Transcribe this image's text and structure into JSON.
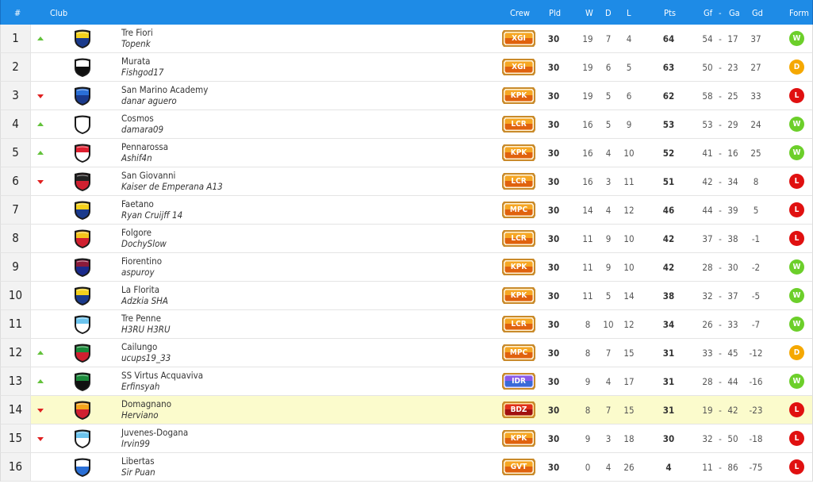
{
  "header": {
    "rank": "#",
    "club": "Club",
    "crew": "Crew",
    "pld": "Pld",
    "w": "W",
    "d": "D",
    "l": "L",
    "pts": "Pts",
    "gf": "Gf",
    "dash": "-",
    "ga": "Ga",
    "gd": "Gd",
    "form": "Form"
  },
  "colors": {
    "header_bg": "#1e8be6",
    "highlight": "#fbfbcc",
    "up": "#63c23b",
    "down": "#e02020",
    "win": "#6ccf2a",
    "draw": "#f5a800",
    "loss": "#e01010"
  },
  "rows": [
    {
      "rank": "1",
      "move": "up",
      "club": "Tre Fiori",
      "manager": "Topenk",
      "crew": "XGI",
      "pld": "30",
      "w": "19",
      "d": "7",
      "l": "4",
      "pts": "64",
      "gf": "54",
      "ga": "17",
      "gd": "37",
      "form": "W",
      "shield": [
        "#f4d11c",
        "#1a3a8c"
      ],
      "crew_color": "orange"
    },
    {
      "rank": "2",
      "move": "none",
      "club": "Murata",
      "manager": "Fishgod17",
      "crew": "XGI",
      "pld": "30",
      "w": "19",
      "d": "6",
      "l": "5",
      "pts": "63",
      "gf": "50",
      "ga": "23",
      "gd": "27",
      "form": "D",
      "shield": [
        "#ffffff",
        "#111111"
      ],
      "crew_color": "orange"
    },
    {
      "rank": "3",
      "move": "down",
      "club": "San Marino Academy",
      "manager": "danar aguero",
      "crew": "KPK",
      "pld": "30",
      "w": "19",
      "d": "5",
      "l": "6",
      "pts": "62",
      "gf": "58",
      "ga": "25",
      "gd": "33",
      "form": "L",
      "shield": [
        "#2a6fd6",
        "#1a3a8c"
      ],
      "crew_color": "orange"
    },
    {
      "rank": "4",
      "move": "up",
      "club": "Cosmos",
      "manager": "damara09",
      "crew": "LCR",
      "pld": "30",
      "w": "16",
      "d": "5",
      "l": "9",
      "pts": "53",
      "gf": "53",
      "ga": "29",
      "gd": "24",
      "form": "W",
      "shield": [
        "#ffffff",
        "#ffffff"
      ],
      "crew_color": "orange"
    },
    {
      "rank": "5",
      "move": "up",
      "club": "Pennarossa",
      "manager": "Ashif4n",
      "crew": "KPK",
      "pld": "30",
      "w": "16",
      "d": "4",
      "l": "10",
      "pts": "52",
      "gf": "41",
      "ga": "16",
      "gd": "25",
      "form": "W",
      "shield": [
        "#e02030",
        "#ffffff"
      ],
      "crew_color": "orange"
    },
    {
      "rank": "6",
      "move": "down",
      "club": "San Giovanni",
      "manager": "Kaiser de Emperana A13",
      "crew": "LCR",
      "pld": "30",
      "w": "16",
      "d": "3",
      "l": "11",
      "pts": "51",
      "gf": "42",
      "ga": "34",
      "gd": "8",
      "form": "L",
      "shield": [
        "#222222",
        "#d02030"
      ],
      "crew_color": "orange"
    },
    {
      "rank": "7",
      "move": "none",
      "club": "Faetano",
      "manager": "Ryan Cruijff 14",
      "crew": "MPC",
      "pld": "30",
      "w": "14",
      "d": "4",
      "l": "12",
      "pts": "46",
      "gf": "44",
      "ga": "39",
      "gd": "5",
      "form": "L",
      "shield": [
        "#f4d11c",
        "#1a3a8c"
      ],
      "crew_color": "orange"
    },
    {
      "rank": "8",
      "move": "none",
      "club": "Folgore",
      "manager": "DochySlow",
      "crew": "LCR",
      "pld": "30",
      "w": "11",
      "d": "9",
      "l": "10",
      "pts": "42",
      "gf": "37",
      "ga": "38",
      "gd": "-1",
      "form": "L",
      "shield": [
        "#f4c51c",
        "#d02030"
      ],
      "crew_color": "orange"
    },
    {
      "rank": "9",
      "move": "none",
      "club": "Fiorentino",
      "manager": "aspuroy",
      "crew": "KPK",
      "pld": "30",
      "w": "11",
      "d": "9",
      "l": "10",
      "pts": "42",
      "gf": "28",
      "ga": "30",
      "gd": "-2",
      "form": "W",
      "shield": [
        "#8a1a3a",
        "#1a2a8c"
      ],
      "crew_color": "orange"
    },
    {
      "rank": "10",
      "move": "none",
      "club": "La Florita",
      "manager": "Adzkia SHA",
      "crew": "KPK",
      "pld": "30",
      "w": "11",
      "d": "5",
      "l": "14",
      "pts": "38",
      "gf": "32",
      "ga": "37",
      "gd": "-5",
      "form": "W",
      "shield": [
        "#f4d11c",
        "#1a3a8c"
      ],
      "crew_color": "orange"
    },
    {
      "rank": "11",
      "move": "none",
      "club": "Tre Penne",
      "manager": "H3RU H3RU",
      "crew": "LCR",
      "pld": "30",
      "w": "8",
      "d": "10",
      "l": "12",
      "pts": "34",
      "gf": "26",
      "ga": "33",
      "gd": "-7",
      "form": "W",
      "shield": [
        "#6cc4ee",
        "#ffffff"
      ],
      "crew_color": "orange"
    },
    {
      "rank": "12",
      "move": "up",
      "club": "Cailungo",
      "manager": "ucups19_33",
      "crew": "MPC",
      "pld": "30",
      "w": "8",
      "d": "7",
      "l": "15",
      "pts": "31",
      "gf": "33",
      "ga": "45",
      "gd": "-12",
      "form": "D",
      "shield": [
        "#1a8a3a",
        "#d02030"
      ],
      "crew_color": "orange"
    },
    {
      "rank": "13",
      "move": "up",
      "club": "SS Virtus Acquaviva",
      "manager": "Erfinsyah",
      "crew": "IDR",
      "pld": "30",
      "w": "9",
      "d": "4",
      "l": "17",
      "pts": "31",
      "gf": "28",
      "ga": "44",
      "gd": "-16",
      "form": "W",
      "shield": [
        "#1a8a3a",
        "#111111"
      ],
      "crew_color": "purple"
    },
    {
      "rank": "14",
      "move": "down",
      "club": "Domagnano",
      "manager": "Herviano",
      "crew": "BDZ",
      "pld": "30",
      "w": "8",
      "d": "7",
      "l": "15",
      "pts": "31",
      "gf": "19",
      "ga": "42",
      "gd": "-23",
      "form": "L",
      "shield": [
        "#f4a51c",
        "#d02030"
      ],
      "crew_color": "red",
      "highlight": true
    },
    {
      "rank": "15",
      "move": "down",
      "club": "Juvenes-Dogana",
      "manager": "Irvin99",
      "crew": "KPK",
      "pld": "30",
      "w": "9",
      "d": "3",
      "l": "18",
      "pts": "30",
      "gf": "32",
      "ga": "50",
      "gd": "-18",
      "form": "L",
      "shield": [
        "#6cc4ee",
        "#ffffff"
      ],
      "crew_color": "orange"
    },
    {
      "rank": "16",
      "move": "none",
      "club": "Libertas",
      "manager": "Sir Puan",
      "crew": "GVT",
      "pld": "30",
      "w": "0",
      "d": "4",
      "l": "26",
      "pts": "4",
      "gf": "11",
      "ga": "86",
      "gd": "-75",
      "form": "L",
      "shield": [
        "#ffffff",
        "#2a6fd6"
      ],
      "crew_color": "orange"
    }
  ]
}
